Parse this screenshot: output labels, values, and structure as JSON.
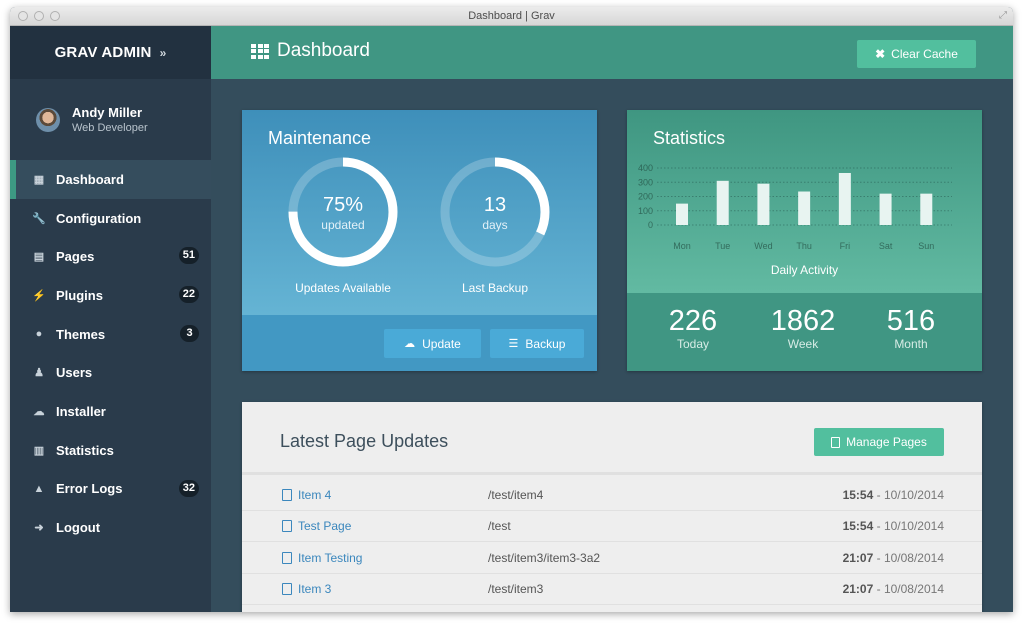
{
  "window": {
    "title": "Dashboard | Grav"
  },
  "sidebar": {
    "brand": "GRAV ADMIN",
    "brand_chevron": "»",
    "user": {
      "name": "Andy Miller",
      "role": "Web Developer"
    },
    "items": [
      {
        "label": "Dashboard",
        "icon": "grid-icon",
        "glyph": "▦",
        "active": true
      },
      {
        "label": "Configuration",
        "icon": "wrench-icon",
        "glyph": "🔧"
      },
      {
        "label": "Pages",
        "icon": "file-icon",
        "glyph": "▤",
        "badge": "51"
      },
      {
        "label": "Plugins",
        "icon": "plug-icon",
        "glyph": "⚡",
        "badge": "22"
      },
      {
        "label": "Themes",
        "icon": "tint-icon",
        "glyph": "●",
        "badge": "3"
      },
      {
        "label": "Users",
        "icon": "user-icon",
        "glyph": "♟"
      },
      {
        "label": "Installer",
        "icon": "cloud-download-icon",
        "glyph": "☁"
      },
      {
        "label": "Statistics",
        "icon": "bar-chart-icon",
        "glyph": "▥"
      },
      {
        "label": "Error Logs",
        "icon": "warning-icon",
        "glyph": "▲",
        "badge": "32"
      },
      {
        "label": "Logout",
        "icon": "sign-out-icon",
        "glyph": "➜"
      }
    ]
  },
  "header": {
    "title": "Dashboard",
    "clear_cache_label": "Clear Cache",
    "clear_cache_glyph": "✖"
  },
  "maintenance": {
    "title": "Maintenance",
    "updates": {
      "value": "75%",
      "sub": "updated",
      "label": "Updates Available",
      "progress": 0.75
    },
    "backup": {
      "value": "13",
      "sub": "days",
      "label": "Last Backup",
      "progress": 0.32
    },
    "update_label": "Update",
    "backup_label": "Backup"
  },
  "statistics": {
    "title": "Statistics",
    "chart_label": "Daily Activity",
    "summary": [
      {
        "value": "226",
        "label": "Today"
      },
      {
        "value": "1862",
        "label": "Week"
      },
      {
        "value": "516",
        "label": "Month"
      }
    ]
  },
  "chart_data": {
    "type": "bar",
    "title": "Daily Activity",
    "categories": [
      "Mon",
      "Tue",
      "Wed",
      "Thu",
      "Fri",
      "Sat",
      "Sun"
    ],
    "values": [
      150,
      310,
      290,
      235,
      365,
      220,
      220
    ],
    "yticks": [
      0,
      100,
      200,
      300,
      400
    ],
    "ylim": [
      0,
      400
    ],
    "xlabel": "Daily Activity",
    "ylabel": "",
    "grid": true
  },
  "latest": {
    "title": "Latest Page Updates",
    "manage_label": "Manage Pages",
    "rows": [
      {
        "title": "Item 4",
        "path": "/test/item4",
        "time": "15:54",
        "date": "- 10/10/2014"
      },
      {
        "title": "Test Page",
        "path": "/test",
        "time": "15:54",
        "date": "- 10/10/2014"
      },
      {
        "title": "Item Testing",
        "path": "/test/item3/item3-3a2",
        "time": "21:07",
        "date": "- 10/08/2014"
      },
      {
        "title": "Item 3",
        "path": "/test/item3",
        "time": "21:07",
        "date": "- 10/08/2014"
      }
    ]
  },
  "colors": {
    "sidebar": "#2a3b4b",
    "header_green": "#409683",
    "accent_green": "#52bf9e",
    "maintenance_blue": "#4298c3",
    "badge": "#152029"
  }
}
